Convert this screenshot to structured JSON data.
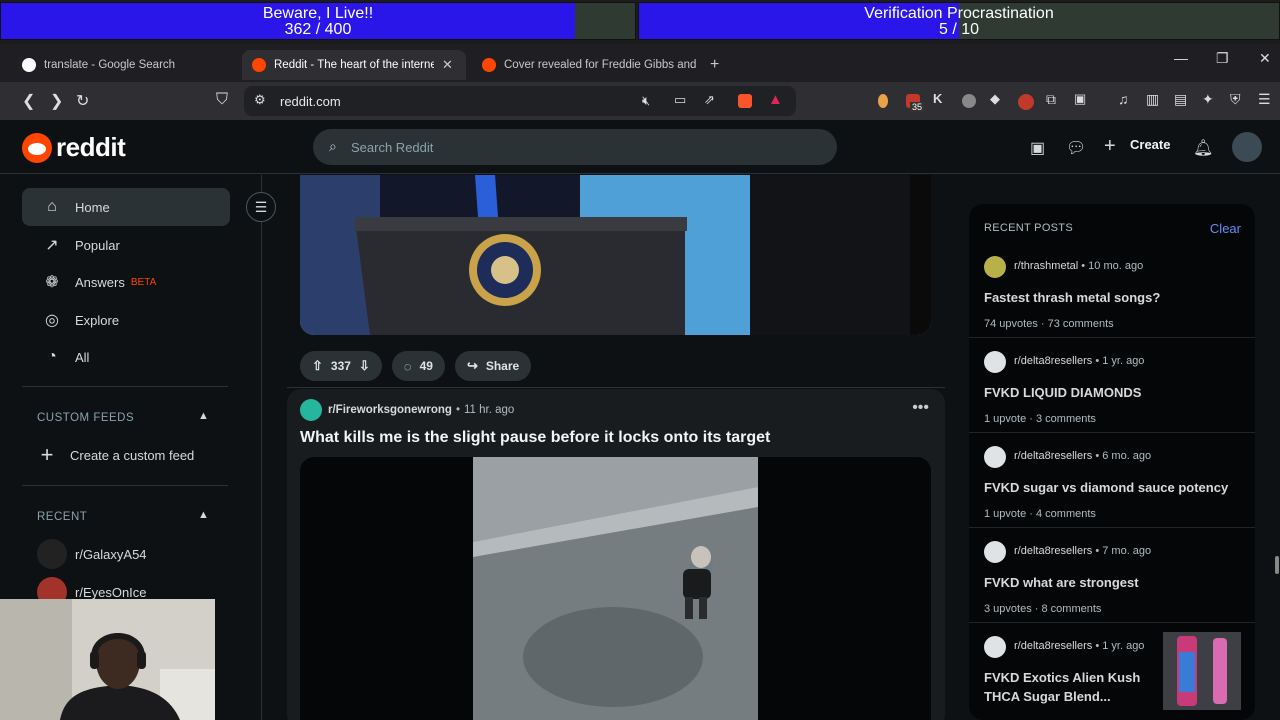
{
  "stream": {
    "bar1": {
      "title": "Beware, I Live!!",
      "progress": "362 / 400",
      "fill_fraction": 0.905
    },
    "bar2": {
      "title": "Verification Procrastination",
      "progress": "5 / 10",
      "fill_fraction": 0.5
    },
    "fill_color": "#2a16e8"
  },
  "browser": {
    "tabs": [
      {
        "label": "translate - Google Search",
        "favicon_color": "#ffffff"
      },
      {
        "label": "Reddit - The heart of the internet",
        "favicon_color": "#ff4500"
      },
      {
        "label": "Cover revealed for Freddie Gibbs and",
        "favicon_color": "#ff4500"
      }
    ],
    "new_tab": "+",
    "url": "reddit.com",
    "badge_count": "35"
  },
  "header": {
    "logo_text": "reddit",
    "search_placeholder": "Search Reddit",
    "create_label": "Create",
    "accent": "#ff4500"
  },
  "sidebar": {
    "items": [
      {
        "label": "Home",
        "icon": "home-icon"
      },
      {
        "label": "Popular",
        "icon": "popular-icon"
      },
      {
        "label": "Answers",
        "badge": "BETA",
        "icon": "answers-icon"
      },
      {
        "label": "Explore",
        "icon": "explore-icon"
      },
      {
        "label": "All",
        "icon": "all-icon"
      }
    ],
    "custom_feeds_heading": "CUSTOM FEEDS",
    "create_custom_feed": "Create a custom feed",
    "recent_heading": "RECENT",
    "recent": [
      {
        "label": "r/GalaxyA54"
      },
      {
        "label": "r/EyesOnIce"
      }
    ]
  },
  "feed": {
    "post1_actions": {
      "upvotes": "337",
      "comments": "49",
      "share": "Share"
    },
    "post2": {
      "subreddit": "r/Fireworksgonewrong",
      "age": "11 hr. ago",
      "title": "What kills me is the slight pause before it locks onto its target"
    }
  },
  "recent_posts": {
    "heading": "RECENT POSTS",
    "clear": "Clear",
    "items": [
      {
        "subreddit": "r/thrashmetal",
        "age": "10 mo. ago",
        "title": "Fastest thrash metal songs?",
        "upvotes": "74 upvotes",
        "comments": "73 comments"
      },
      {
        "subreddit": "r/delta8resellers",
        "age": "1 yr. ago",
        "title": "FVKD LIQUID DIAMONDS",
        "upvotes": "1 upvote",
        "comments": "3 comments"
      },
      {
        "subreddit": "r/delta8resellers",
        "age": "6 mo. ago",
        "title": "FVKD sugar vs diamond sauce potency",
        "upvotes": "1 upvote",
        "comments": "4 comments"
      },
      {
        "subreddit": "r/delta8resellers",
        "age": "7 mo. ago",
        "title": "FVKD what are strongest",
        "upvotes": "3 upvotes",
        "comments": "8 comments"
      },
      {
        "subreddit": "r/delta8resellers",
        "age": "1 yr. ago",
        "title": "FVKD Exotics Alien Kush THCA Sugar Blend...",
        "upvotes": "",
        "comments": ""
      }
    ]
  }
}
